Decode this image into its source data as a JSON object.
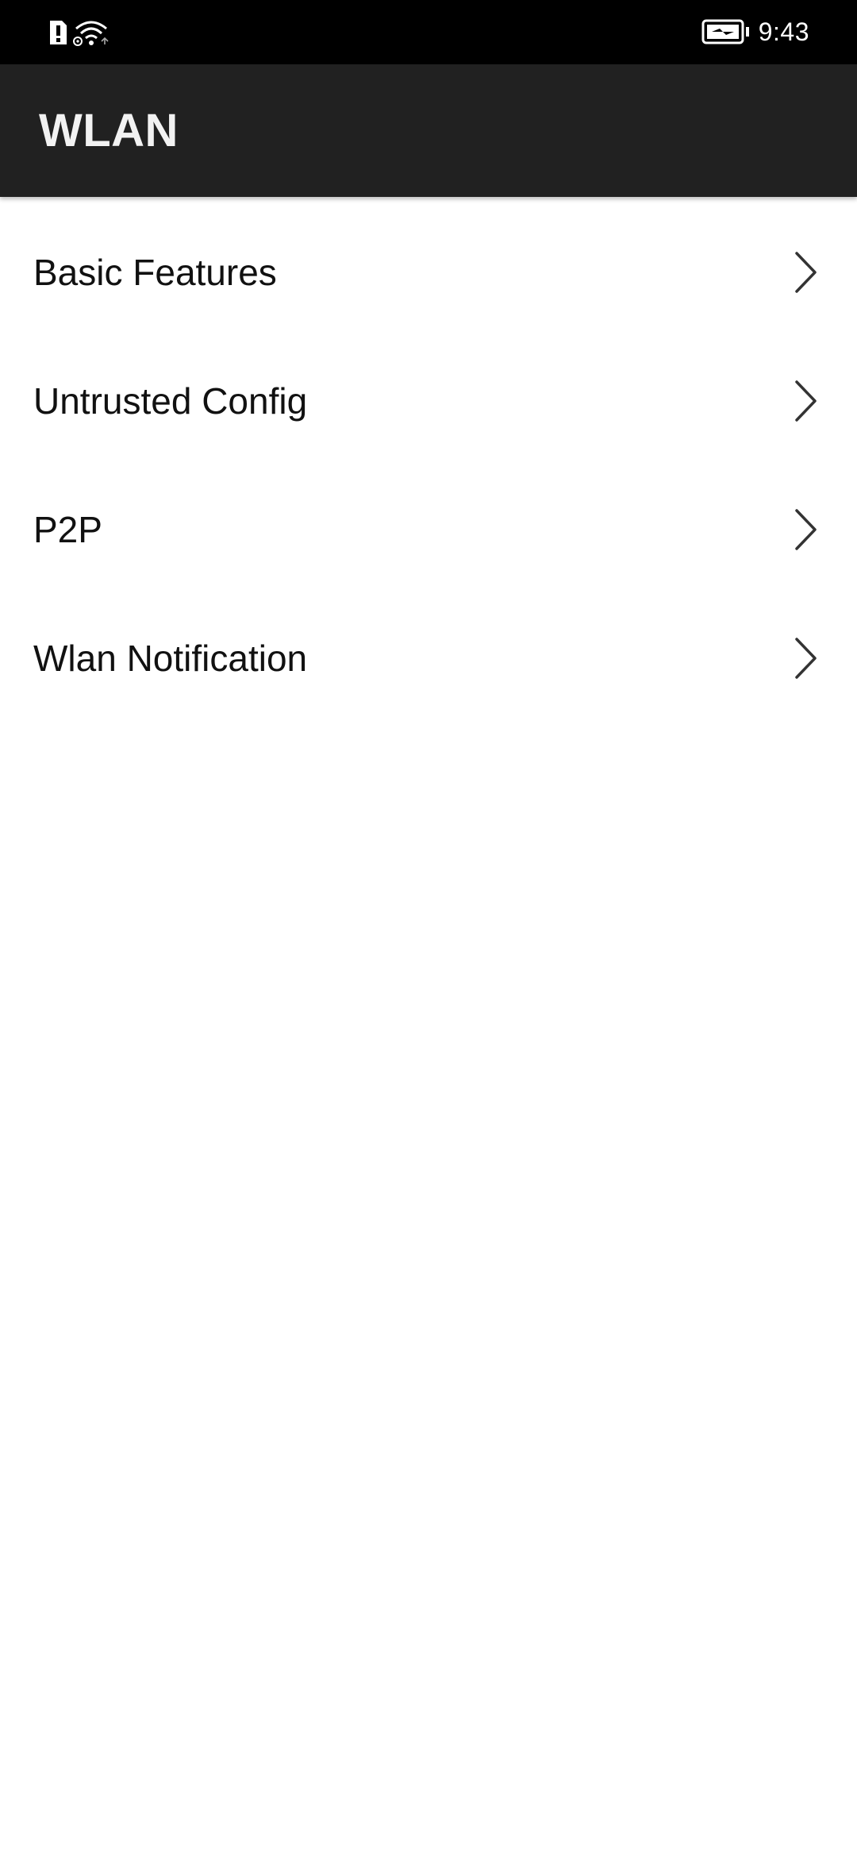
{
  "status_bar": {
    "time": "9:43",
    "icons": [
      "alert-icon",
      "wifi-hotspot-icon",
      "wifi-icon",
      "battery-charging-icon"
    ]
  },
  "app_bar": {
    "title": "WLAN"
  },
  "menu": {
    "items": [
      {
        "label": "Basic Features",
        "icon": "chevron-right-icon"
      },
      {
        "label": "Untrusted Config",
        "icon": "chevron-right-icon"
      },
      {
        "label": "P2P",
        "icon": "chevron-right-icon"
      },
      {
        "label": "Wlan Notification",
        "icon": "chevron-right-icon"
      }
    ]
  },
  "colors": {
    "status_bar_bg": "#000000",
    "app_bar_bg": "#212121",
    "app_title": "#f2f2f2",
    "page_bg": "#ffffff",
    "item_text": "#111111",
    "chevron": "#333333"
  }
}
